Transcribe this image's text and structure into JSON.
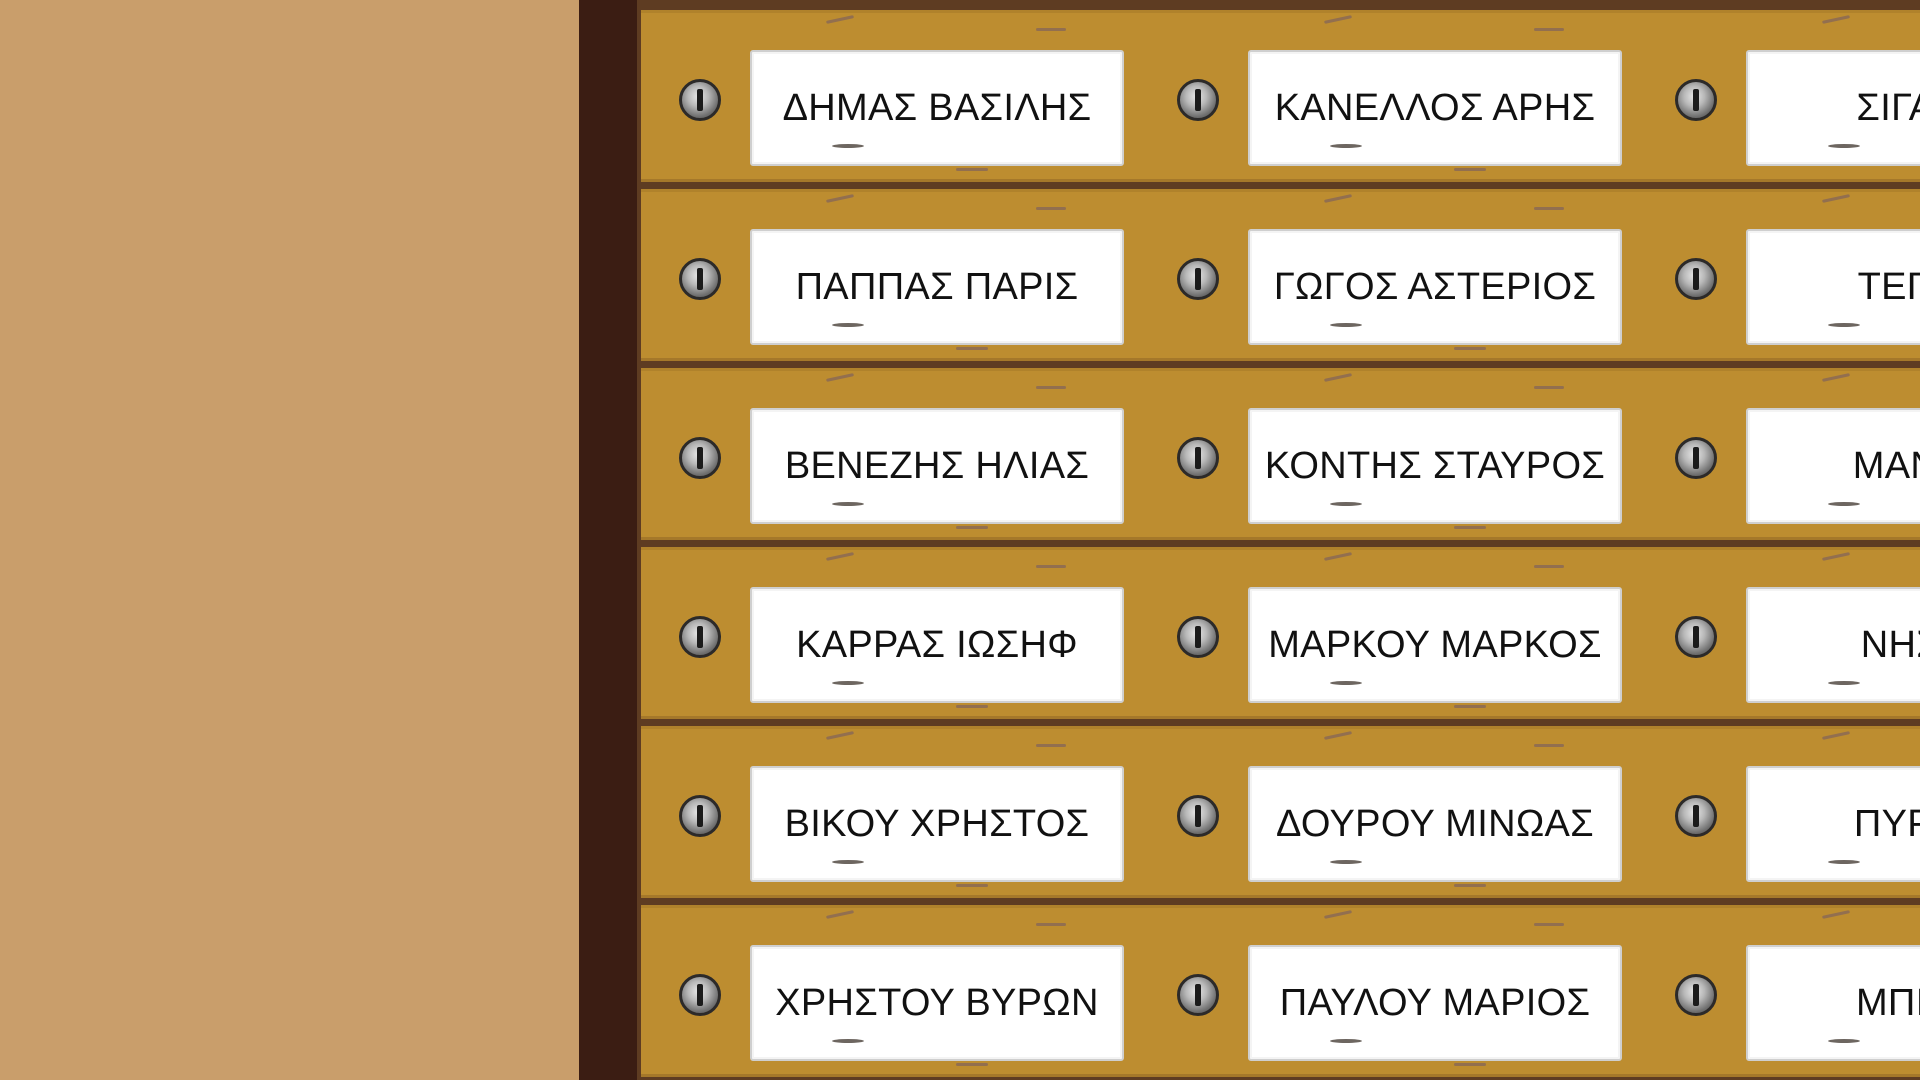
{
  "colors": {
    "wall": "#c99e6b",
    "cabinet_side": "#3b1d13",
    "cabinet_frame": "#5e3c22",
    "drawer": "#bd8d30",
    "label_bg": "#ffffff",
    "label_text": "#111111"
  },
  "icons": {
    "drawer_knob": "screw-knob-icon"
  },
  "drawers": [
    {
      "row": 1,
      "col": 1,
      "label": "ΔΗΜΑΣ ΒΑΣΙΛΗΣ"
    },
    {
      "row": 1,
      "col": 2,
      "label": "ΚΑΝΕΛΛΟΣ ΑΡΗΣ"
    },
    {
      "row": 1,
      "col": 3,
      "label": "ΣΙΓΑΛΑΣ"
    },
    {
      "row": 2,
      "col": 1,
      "label": "ΠΑΠΠΑΣ ΠΑΡΙΣ"
    },
    {
      "row": 2,
      "col": 2,
      "label": "ΓΩΓΟΣ ΑΣΤΕΡΙΟΣ"
    },
    {
      "row": 2,
      "col": 3,
      "label": "ΤΕΓΑΣ Α"
    },
    {
      "row": 3,
      "col": 1,
      "label": "ΒΕΝΕΖΗΣ ΗΛΙΑΣ"
    },
    {
      "row": 3,
      "col": 2,
      "label": "ΚΟΝΤΗΣ ΣΤΑΥΡΟΣ"
    },
    {
      "row": 3,
      "col": 3,
      "label": "ΜΑΝΤΗΣ"
    },
    {
      "row": 4,
      "col": 1,
      "label": "ΚΑΡΡΑΣ ΙΩΣΗΦ"
    },
    {
      "row": 4,
      "col": 2,
      "label": "ΜΑΡΚΟΥ ΜΑΡΚΟΣ"
    },
    {
      "row": 4,
      "col": 3,
      "label": "ΝΗΣΙΟΥ"
    },
    {
      "row": 5,
      "col": 1,
      "label": "ΒΙΚΟΥ ΧΡΗΣΤΟΣ"
    },
    {
      "row": 5,
      "col": 2,
      "label": "ΔΟΥΡΟΥ ΜΙΝΩΑΣ"
    },
    {
      "row": 5,
      "col": 3,
      "label": "ΠΥΡΡΟΣ"
    },
    {
      "row": 6,
      "col": 1,
      "label": "ΧΡΗΣΤΟΥ ΒΥΡΩΝ"
    },
    {
      "row": 6,
      "col": 2,
      "label": "ΠΑΥΛΟΥ ΜΑΡΙΟΣ"
    },
    {
      "row": 6,
      "col": 3,
      "label": "ΜΠΙΣΜΠ"
    }
  ]
}
